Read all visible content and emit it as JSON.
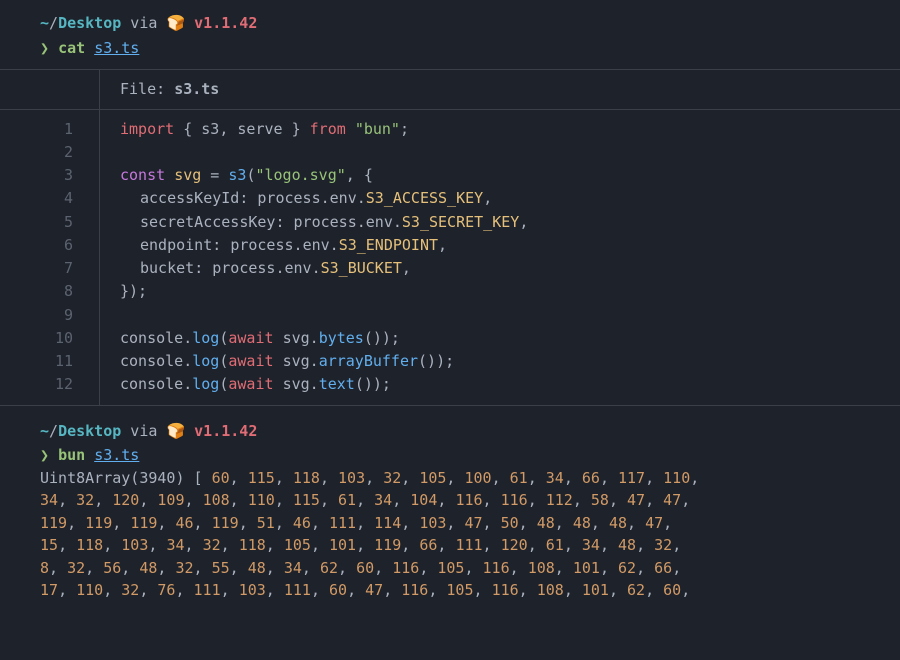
{
  "prompt1": {
    "tilde": "~",
    "slash": "/",
    "path": "Desktop",
    "via": " via ",
    "icon": "🍞",
    "version": "v1.1.42",
    "caret": "❯",
    "cmd": "cat",
    "arg": "s3.ts"
  },
  "file": {
    "label": "File: ",
    "name": "s3.ts",
    "lineNums": [
      "1",
      "2",
      "3",
      "4",
      "5",
      "6",
      "7",
      "8",
      "9",
      "10",
      "11",
      "12"
    ],
    "code": {
      "l1": {
        "import": "import",
        "brace_o": " { ",
        "s3": "s3",
        "comma": ", ",
        "serve": "serve",
        "brace_c": " } ",
        "from": "from",
        "sp": " ",
        "str": "\"bun\"",
        "semi": ";"
      },
      "l2": "",
      "l3": {
        "const": "const",
        "sp1": " ",
        "svg": "svg",
        "eq": " = ",
        "s3": "s3",
        "paren": "(",
        "str": "\"logo.svg\"",
        "comma": ", {"
      },
      "l4": {
        "key": "accessKeyId",
        "colon": ": ",
        "proc": "process",
        "dot1": ".",
        "env": "env",
        "dot2": ".",
        "prop": "S3_ACCESS_KEY",
        "comma": ","
      },
      "l5": {
        "key": "secretAccessKey",
        "colon": ": ",
        "proc": "process",
        "dot1": ".",
        "env": "env",
        "dot2": ".",
        "prop": "S3_SECRET_KEY",
        "comma": ","
      },
      "l6": {
        "key": "endpoint",
        "colon": ": ",
        "proc": "process",
        "dot1": ".",
        "env": "env",
        "dot2": ".",
        "prop": "S3_ENDPOINT",
        "comma": ","
      },
      "l7": {
        "key": "bucket",
        "colon": ": ",
        "proc": "process",
        "dot1": ".",
        "env": "env",
        "dot2": ".",
        "prop": "S3_BUCKET",
        "comma": ","
      },
      "l8": {
        "close": "});"
      },
      "l9": "",
      "l10": {
        "console": "console",
        "dot": ".",
        "log": "log",
        "p1": "(",
        "await": "await",
        "sp": " ",
        "svg": "svg",
        "dot2": ".",
        "method": "bytes",
        "p2": "());"
      },
      "l11": {
        "console": "console",
        "dot": ".",
        "log": "log",
        "p1": "(",
        "await": "await",
        "sp": " ",
        "svg": "svg",
        "dot2": ".",
        "method": "arrayBuffer",
        "p2": "());"
      },
      "l12": {
        "console": "console",
        "dot": ".",
        "log": "log",
        "p1": "(",
        "await": "await",
        "sp": " ",
        "svg": "svg",
        "dot2": ".",
        "method": "text",
        "p2": "());"
      }
    }
  },
  "prompt2": {
    "tilde": "~",
    "slash": "/",
    "path": "Desktop",
    "via": " via ",
    "icon": "🍞",
    "version": "v1.1.42",
    "caret": "❯",
    "cmd": "bun",
    "arg": "s3.ts"
  },
  "output": {
    "head": "Uint8Array(3940) ",
    "open": "[ ",
    "rows": [
      [
        "60",
        "115",
        "118",
        "103",
        "32",
        "105",
        "100",
        "61",
        "34",
        "66",
        "117",
        "110"
      ],
      [
        "34",
        "32",
        "120",
        "109",
        "108",
        "110",
        "115",
        "61",
        "34",
        "104",
        "116",
        "116",
        "112",
        "58",
        "47",
        "47"
      ],
      [
        "119",
        "119",
        "119",
        "46",
        "119",
        "51",
        "46",
        "111",
        "114",
        "103",
        "47",
        "50",
        "48",
        "48",
        "48",
        "47"
      ],
      [
        "15",
        "118",
        "103",
        "34",
        "32",
        "118",
        "105",
        "101",
        "119",
        "66",
        "111",
        "120",
        "61",
        "34",
        "48",
        "32"
      ],
      [
        "8",
        "32",
        "56",
        "48",
        "32",
        "55",
        "48",
        "34",
        "62",
        "60",
        "116",
        "105",
        "116",
        "108",
        "101",
        "62",
        "66"
      ],
      [
        "17",
        "110",
        "32",
        "76",
        "111",
        "103",
        "111",
        "60",
        "47",
        "116",
        "105",
        "116",
        "108",
        "101",
        "62",
        "60"
      ]
    ],
    "sep": ", "
  }
}
